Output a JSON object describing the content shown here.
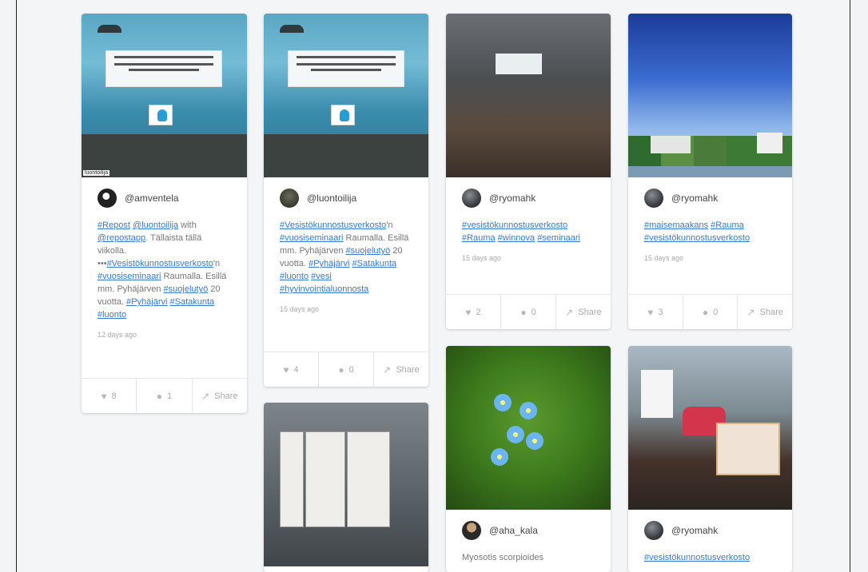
{
  "cards": [
    {
      "handle": "@amventela",
      "caption_parts": [
        {
          "t": "#Repost",
          "tag": true
        },
        {
          "t": " ",
          "tag": false
        },
        {
          "t": "@luontoilija",
          "tag": true
        },
        {
          "t": " with ",
          "tag": false
        },
        {
          "t": "@repostapp",
          "tag": true
        },
        {
          "t": ". Tällaista tällä viikolla. •••",
          "tag": false
        },
        {
          "t": "#Vesistökunnostusverkosto",
          "tag": true
        },
        {
          "t": "'n ",
          "tag": false
        },
        {
          "t": "#vuosiseminaari",
          "tag": true
        },
        {
          "t": " Raumalla. Esillä mm. Pyhäjärven ",
          "tag": false
        },
        {
          "t": "#suojelutyö",
          "tag": true
        },
        {
          "t": " 20 vuotta. ",
          "tag": false
        },
        {
          "t": "#Pyhäjärvi",
          "tag": true
        },
        {
          "t": " ",
          "tag": false
        },
        {
          "t": "#Satakunta",
          "tag": true
        },
        {
          "t": " ",
          "tag": false
        },
        {
          "t": "#luonto",
          "tag": true
        }
      ],
      "time": "12 days ago",
      "likes": "8",
      "comments": "1",
      "share": "Share",
      "image_credit": "luontoilija"
    },
    {
      "handle": "@luontoilija",
      "caption_parts": [
        {
          "t": "#Vesistökunnostusverkosto",
          "tag": true
        },
        {
          "t": "'n ",
          "tag": false
        },
        {
          "t": "#vuosiseminaari",
          "tag": true
        },
        {
          "t": " Raumalla. Esillä mm. Pyhäjärven ",
          "tag": false
        },
        {
          "t": "#suojelutyö",
          "tag": true
        },
        {
          "t": " 20 vuotta. ",
          "tag": false
        },
        {
          "t": "#Pyhäjärvi",
          "tag": true
        },
        {
          "t": " ",
          "tag": false
        },
        {
          "t": "#Satakunta",
          "tag": true
        },
        {
          "t": " ",
          "tag": false
        },
        {
          "t": "#luonto",
          "tag": true
        },
        {
          "t": " ",
          "tag": false
        },
        {
          "t": "#vesi",
          "tag": true
        },
        {
          "t": " ",
          "tag": false
        },
        {
          "t": "#hyvinvointialuonnosta",
          "tag": true
        }
      ],
      "time": "15 days ago",
      "likes": "4",
      "comments": "0",
      "share": "Share"
    },
    {
      "handle": "@ryomahk",
      "caption_parts": [
        {
          "t": "#vesistökunnostusverkosto",
          "tag": true
        },
        {
          "t": " ",
          "tag": false
        },
        {
          "t": "#Rauma",
          "tag": true
        },
        {
          "t": " ",
          "tag": false
        },
        {
          "t": "#winnova",
          "tag": true
        },
        {
          "t": " ",
          "tag": false
        },
        {
          "t": "#seminaari",
          "tag": true
        }
      ],
      "time": "15 days ago",
      "likes": "2",
      "comments": "0",
      "share": "Share"
    },
    {
      "handle": "@ryomahk",
      "caption_parts": [
        {
          "t": "#maisemaakans",
          "tag": true
        },
        {
          "t": " ",
          "tag": false
        },
        {
          "t": "#Rauma",
          "tag": true
        },
        {
          "t": " ",
          "tag": false
        },
        {
          "t": "#vesistökunnostusverkosto",
          "tag": true
        }
      ],
      "time": "15 days ago",
      "likes": "3",
      "comments": "0",
      "share": "Share"
    },
    {
      "handle": "@aha_kala",
      "caption_parts": [
        {
          "t": "Myosotis scorpioides",
          "tag": false
        }
      ]
    },
    {
      "handle": "@ryomahk",
      "caption_parts": [
        {
          "t": "#vesistökunnostusverkosto",
          "tag": true
        }
      ]
    }
  ]
}
